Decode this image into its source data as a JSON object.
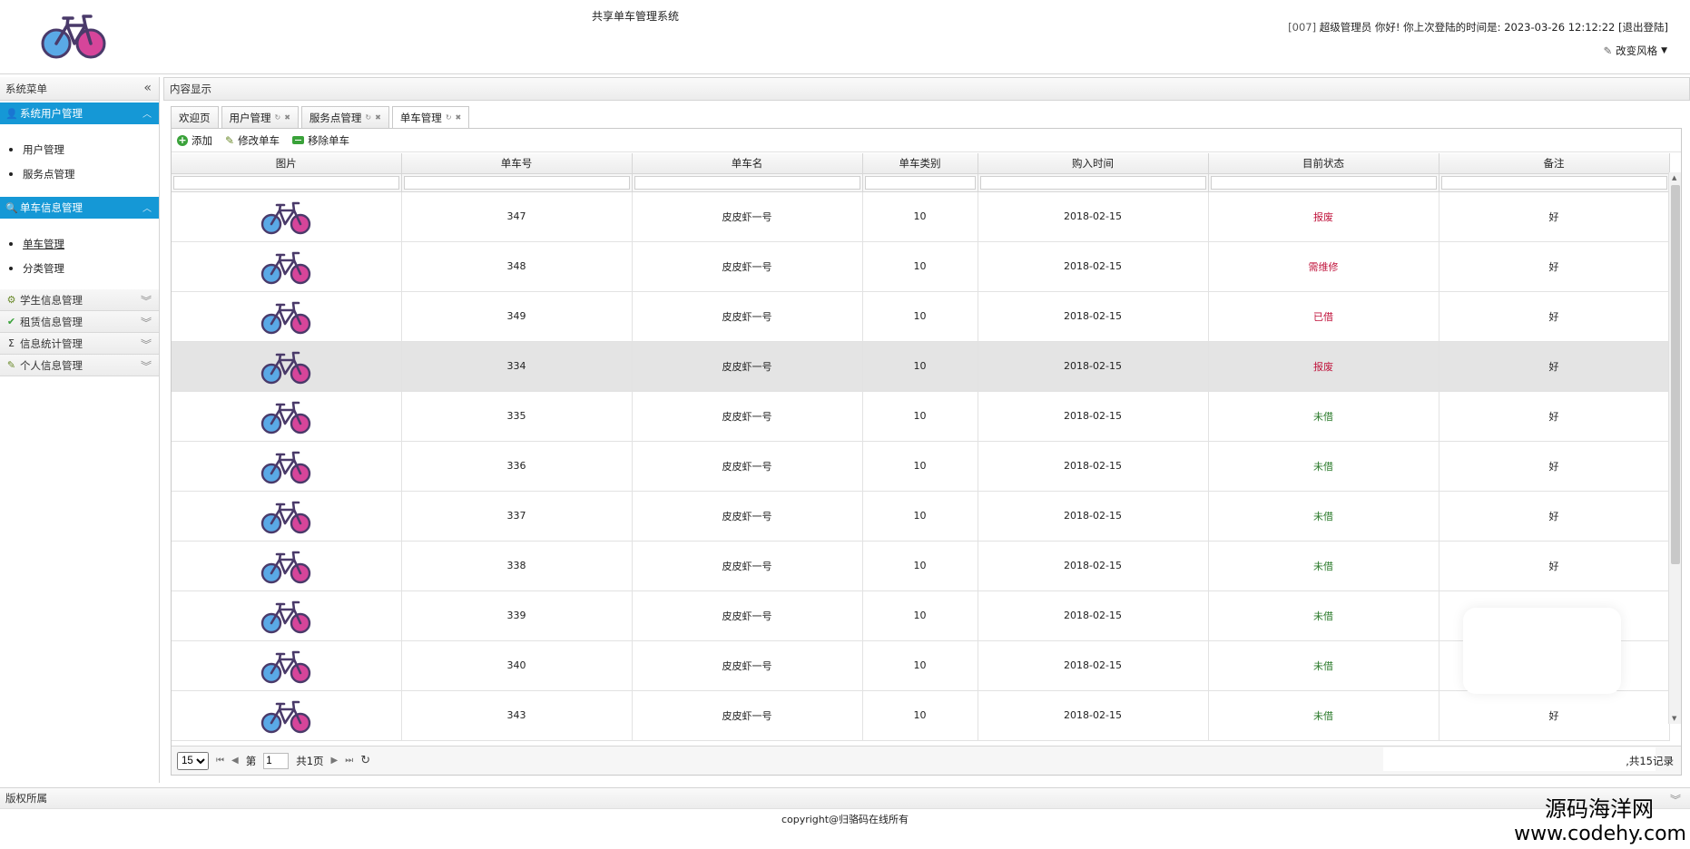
{
  "header": {
    "title": "共享单车管理系统",
    "user_id": "[007]",
    "greeting": "超级管理员 你好! 你上次登陆的时间是: 2023-03-26 12:12:22",
    "logout": "[退出登陆]",
    "style_switch": "改变风格"
  },
  "sidebar": {
    "title": "系统菜单",
    "groups": [
      {
        "label": "系统用户管理",
        "items": [
          "用户管理",
          "服务点管理"
        ]
      },
      {
        "label": "单车信息管理",
        "items": [
          "单车管理",
          "分类管理"
        ]
      },
      {
        "label": "学生信息管理"
      },
      {
        "label": "租赁信息管理"
      },
      {
        "label": "信息统计管理"
      },
      {
        "label": "个人信息管理"
      }
    ]
  },
  "main": {
    "title": "内容显示",
    "tabs": [
      "欢迎页",
      "用户管理",
      "服务点管理",
      "单车管理"
    ],
    "toolbar": {
      "add": "添加",
      "edit": "修改单车",
      "remove": "移除单车"
    },
    "columns": [
      "图片",
      "单车号",
      "单车名",
      "单车类别",
      "购入时间",
      "目前状态",
      "备注"
    ],
    "rows": [
      {
        "no": "347",
        "name": "皮皮虾一号",
        "category": "10",
        "date": "2018-02-15",
        "status": "报废",
        "status_type": "red",
        "note": "好"
      },
      {
        "no": "348",
        "name": "皮皮虾一号",
        "category": "10",
        "date": "2018-02-15",
        "status": "需维修",
        "status_type": "red",
        "note": "好"
      },
      {
        "no": "349",
        "name": "皮皮虾一号",
        "category": "10",
        "date": "2018-02-15",
        "status": "已借",
        "status_type": "red",
        "note": "好"
      },
      {
        "no": "334",
        "name": "皮皮虾一号",
        "category": "10",
        "date": "2018-02-15",
        "status": "报废",
        "status_type": "red",
        "note": "好"
      },
      {
        "no": "335",
        "name": "皮皮虾一号",
        "category": "10",
        "date": "2018-02-15",
        "status": "未借",
        "status_type": "green",
        "note": "好"
      },
      {
        "no": "336",
        "name": "皮皮虾一号",
        "category": "10",
        "date": "2018-02-15",
        "status": "未借",
        "status_type": "green",
        "note": "好"
      },
      {
        "no": "337",
        "name": "皮皮虾一号",
        "category": "10",
        "date": "2018-02-15",
        "status": "未借",
        "status_type": "green",
        "note": "好"
      },
      {
        "no": "338",
        "name": "皮皮虾一号",
        "category": "10",
        "date": "2018-02-15",
        "status": "未借",
        "status_type": "green",
        "note": "好"
      },
      {
        "no": "339",
        "name": "皮皮虾一号",
        "category": "10",
        "date": "2018-02-15",
        "status": "未借",
        "status_type": "green",
        "note": ""
      },
      {
        "no": "340",
        "name": "皮皮虾一号",
        "category": "10",
        "date": "2018-02-15",
        "status": "未借",
        "status_type": "green",
        "note": ""
      },
      {
        "no": "343",
        "name": "皮皮虾一号",
        "category": "10",
        "date": "2018-02-15",
        "status": "未借",
        "status_type": "green",
        "note": "好"
      }
    ],
    "selected_row": "334",
    "pager": {
      "page_size": "15",
      "page_prefix": "第",
      "page": "1",
      "page_total": "共1页",
      "total": ",共15记录"
    }
  },
  "footer": {
    "title": "版权所属",
    "copyright": "copyright@归骆码在线所有"
  },
  "watermark": {
    "line1": "源码海洋网",
    "line2": "www.codehy.com"
  },
  "colors": {
    "accent": "#1598d6",
    "status_red": "#c0143c",
    "status_green": "#2a7a2a",
    "bike_blue": "#5aa9e6",
    "bike_pink": "#d6459a"
  }
}
